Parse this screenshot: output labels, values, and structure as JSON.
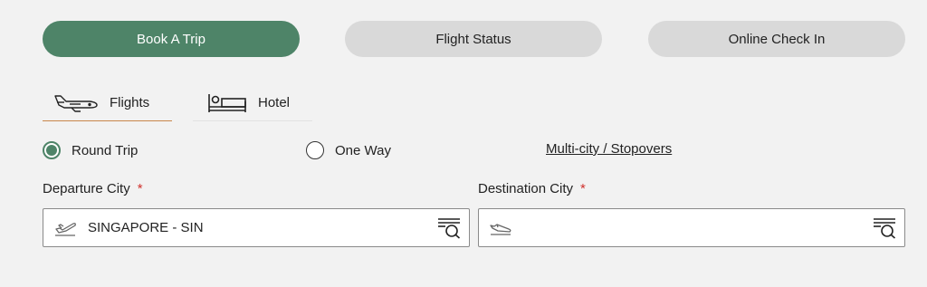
{
  "top_tabs": {
    "book": "Book A Trip",
    "status": "Flight Status",
    "checkin": "Online Check In"
  },
  "sub_tabs": {
    "flights": "Flights",
    "hotel": "Hotel"
  },
  "trip_type": {
    "round_trip": "Round Trip",
    "one_way": "One Way",
    "multi_city": "Multi-city / Stopovers",
    "selected": "Round Trip"
  },
  "departure": {
    "label": "Departure City",
    "required_mark": "*",
    "value": "SINGAPORE - SIN",
    "icon": "plane-takeoff-icon"
  },
  "destination": {
    "label": "Destination City",
    "required_mark": "*",
    "value": "",
    "icon": "plane-landing-icon"
  },
  "colors": {
    "accent": "#4e8468",
    "tab_underline": "#c8864a",
    "required": "#d0312d",
    "background": "#f2f2f2"
  }
}
